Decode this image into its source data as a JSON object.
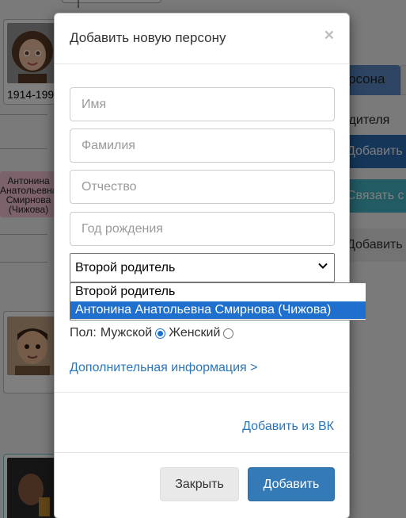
{
  "background": {
    "years": [
      "1914-199"
    ],
    "pink_card_text": "Антонина Анатольевна Смирнова (Чижова)",
    "tab_label": "рсона",
    "parent_text": "одителя",
    "blue_button": "Добавить",
    "teal_button": "Связать с",
    "gray_button": "Добавить"
  },
  "modal": {
    "title": "Добавить новую персону",
    "close_symbol": "×",
    "fields": {
      "first_name_placeholder": "Имя",
      "last_name_placeholder": "Фамилия",
      "patronymic_placeholder": "Отчество",
      "birth_year_placeholder": "Год рождения"
    },
    "parent_select": {
      "value": "Второй родитель",
      "options": [
        "Второй родитель",
        "Антонина Анатольевна Смирнова (Чижова)"
      ],
      "highlighted_index": 1
    },
    "gender": {
      "label": "Пол:",
      "male": "Мужской",
      "female": "Женский",
      "selected": "male"
    },
    "more_info_link": "Дополнительная информация >",
    "vk_link": "Добавить из ВК",
    "close_button": "Закрыть",
    "add_button": "Добавить"
  },
  "colors": {
    "primary": "#337ab7",
    "link": "#2a76bb",
    "highlight": "#1e6fce"
  }
}
